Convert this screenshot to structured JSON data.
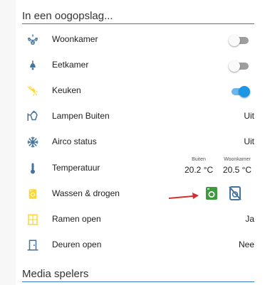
{
  "sections": {
    "overview_title": "In een oogopslag...",
    "media_title": "Media spelers"
  },
  "rows": [
    {
      "label": "Woonkamer",
      "icon": "chandelier-icon",
      "state_type": "toggle",
      "on": false
    },
    {
      "label": "Eetkamer",
      "icon": "ceiling-light-icon",
      "state_type": "toggle",
      "on": false
    },
    {
      "label": "Keuken",
      "icon": "spotlight-icon",
      "state_type": "toggle",
      "on": true
    },
    {
      "label": "Lampen Buiten",
      "icon": "outdoor-lamp-icon",
      "state_type": "text",
      "state": "Uit"
    },
    {
      "label": "Airco status",
      "icon": "snowflake-off-icon",
      "state_type": "text",
      "state": "Uit"
    },
    {
      "label": "Temperatuur",
      "icon": "thermometer-icon",
      "state_type": "temps"
    },
    {
      "label": "Wassen & drogen",
      "icon": "washing-machine-icon",
      "state_type": "icons"
    },
    {
      "label": "Ramen open",
      "icon": "window-icon",
      "state_type": "text",
      "state": "Ja"
    },
    {
      "label": "Deuren open",
      "icon": "door-icon",
      "state_type": "text",
      "state": "Nee"
    }
  ],
  "temperatures": [
    {
      "name": "Buiten",
      "value": "20.2 °C"
    },
    {
      "name": "Woonkamer",
      "value": "20.5 °C"
    }
  ],
  "colors": {
    "icon_blue": "#44739e",
    "active_yellow": "#fdd835",
    "accent_blue": "#1e96e6",
    "washer_green": "#3d9a3d",
    "arrow_red": "#d32f2f",
    "section_line": "#3b7bbf"
  }
}
